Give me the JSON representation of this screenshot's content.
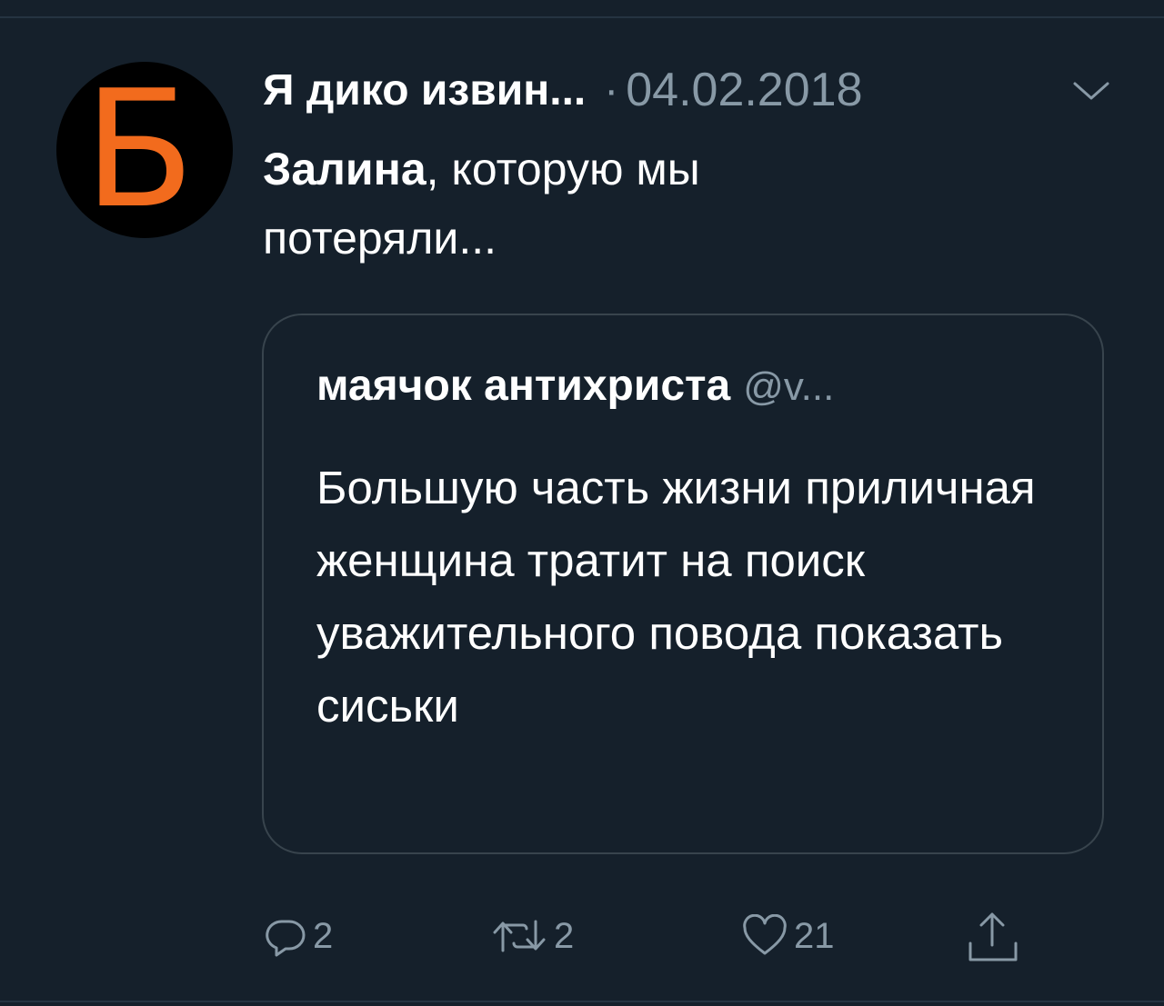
{
  "tweet": {
    "display_name": "Я дико извин...",
    "separator": "·",
    "date": "04.02.2018",
    "avatar_letter": "Б",
    "avatar_dot": ",",
    "text_mention": "Залина",
    "text_rest": ", которую мы потеряли..."
  },
  "quote": {
    "display_name": "маячок антихриста",
    "handle": "@v...",
    "text": "Большую часть жизни приличная женщина тратит на поиск уважительного повода показать сиськи"
  },
  "actions": {
    "reply_count": "2",
    "retweet_count": "2",
    "like_count": "21"
  },
  "icons": {
    "more": "chevron-down-icon",
    "reply": "reply-icon",
    "retweet": "retweet-icon",
    "like": "heart-icon",
    "share": "share-icon"
  },
  "colors": {
    "background": "#15202b",
    "secondary_text": "#8899a6",
    "avatar_accent": "#f26b1d",
    "border": "#38444d"
  }
}
